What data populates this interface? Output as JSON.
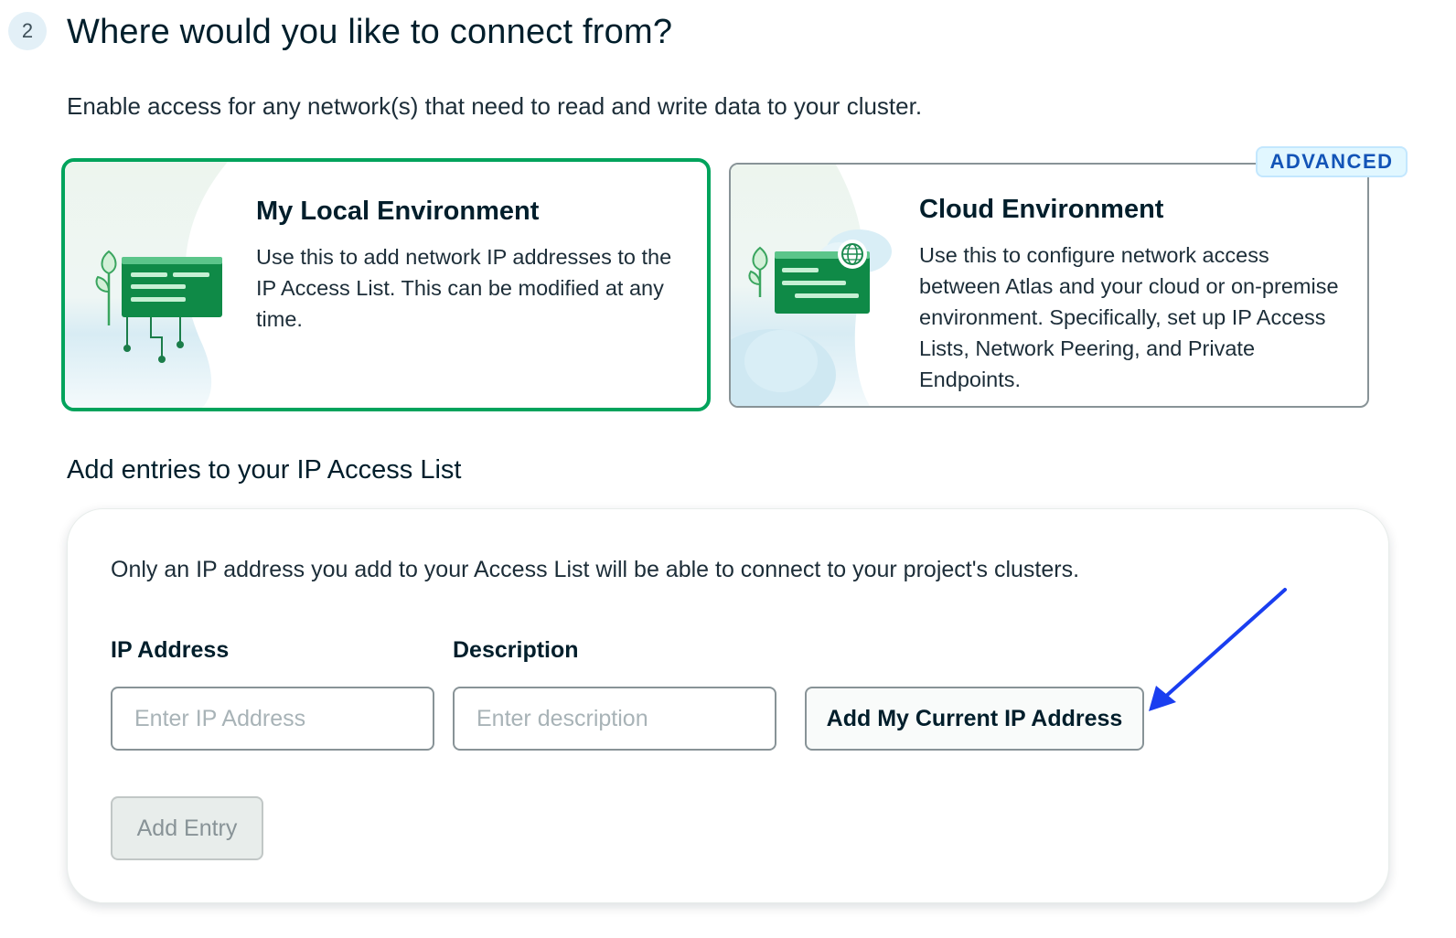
{
  "step": {
    "number": "2",
    "title": "Where would you like to connect from?"
  },
  "subtitle": "Enable access for any network(s) that need to read and write data to your cluster.",
  "options": [
    {
      "title": "My Local Environment",
      "description": "Use this to add network IP addresses to the IP Access List. This can be modified at any time.",
      "selected": true
    },
    {
      "title": "Cloud Environment",
      "description": "Use this to configure network access between Atlas and your cloud or on-premise environment. Specifically, set up IP Access Lists, Network Peering, and Private Endpoints.",
      "badge": "ADVANCED",
      "selected": false
    }
  ],
  "access_list": {
    "heading": "Add entries to your IP Access List",
    "note": "Only an IP address you add to your Access List will be able to connect to your project's clusters.",
    "ip_label": "IP Address",
    "ip_placeholder": "Enter IP Address",
    "ip_value": "",
    "description_label": "Description",
    "description_placeholder": "Enter description",
    "description_value": "",
    "add_current_ip_button": "Add My Current IP Address",
    "add_entry_button": "Add Entry",
    "add_entry_disabled": true
  },
  "colors": {
    "selected_border": "#00a35c",
    "card_border": "#889397",
    "badge_text": "#1254b7",
    "badge_bg": "#e1f7ff",
    "annotation_arrow": "#1a3ef0"
  },
  "icons": {
    "local_illustration": "browser-window-with-plant-and-circuits",
    "cloud_illustration": "browser-window-with-cloud-and-globe",
    "annotation": "pointer-arrow"
  }
}
